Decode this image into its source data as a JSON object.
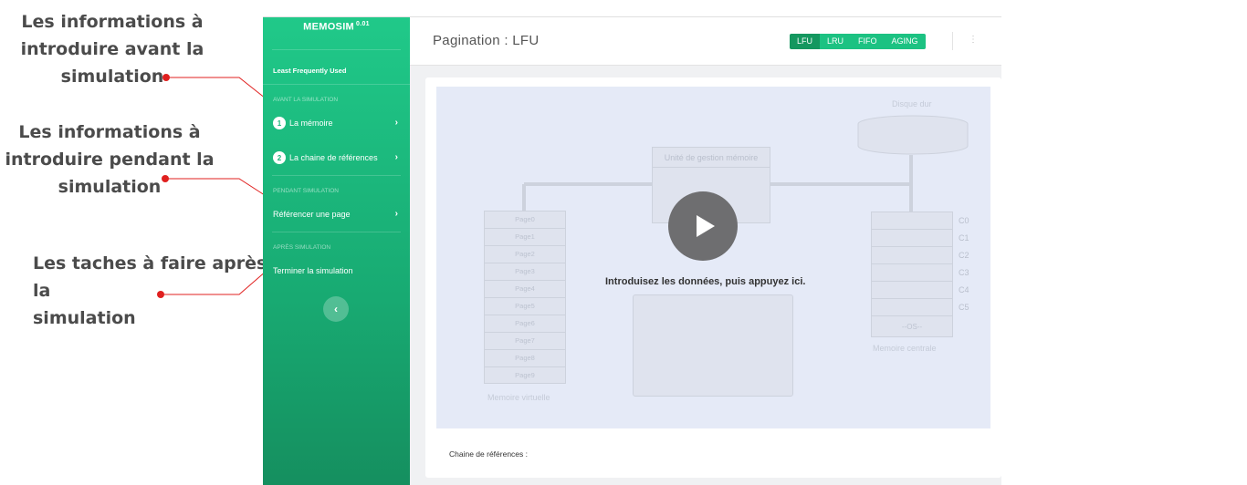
{
  "annotations": {
    "before": [
      "Les informations à",
      "introduire avant la",
      "simulation"
    ],
    "during": [
      "Les informations à",
      "introduire pendant la",
      "simulation"
    ],
    "after": [
      "Les taches à faire après la",
      "simulation"
    ]
  },
  "sidebar": {
    "brand": "MEMOSIM",
    "version": "0.01",
    "subtitle": "Least Frequently Used",
    "sections": [
      {
        "title": "AVANT LA SIMULATION",
        "items": [
          {
            "num": "1",
            "label": "La mémoire"
          },
          {
            "num": "2",
            "label": "La chaine de références"
          }
        ]
      },
      {
        "title": "PENDANT SIMULATION",
        "items": [
          {
            "label": "Référencer une page"
          }
        ]
      },
      {
        "title": "APRÈS SIMULATION",
        "items": [
          {
            "label": "Terminer la simulation"
          }
        ]
      }
    ],
    "collapse_icon": "chevron-left-icon"
  },
  "header": {
    "title": "Pagination : LFU",
    "algorithms": [
      "LFU",
      "LRU",
      "FIFO",
      "AGING"
    ],
    "active_algorithm": "LFU",
    "menu_icon": "kebab-menu-icon"
  },
  "simulation": {
    "hard_disk_label": "Disque dur",
    "mmu_label": "Unité de gestion mémoire",
    "virtual_memory_label": "Memoire virtuelle",
    "virtual_pages": [
      "Page0",
      "Page1",
      "Page2",
      "Page3",
      "Page4",
      "Page5",
      "Page6",
      "Page7",
      "Page8",
      "Page9"
    ],
    "central_memory_label": "Memoire centrale",
    "frames": [
      "C0",
      "C1",
      "C2",
      "C3",
      "C4",
      "C5"
    ],
    "os_label": "--OS--",
    "cta": "Introduisez les données, puis appuyez ici."
  },
  "footer": {
    "reference_chain_label": "Chaine de références :"
  },
  "colors": {
    "sidebar_green": "#20c989",
    "accent": "#1cc282",
    "annotation_red": "#e0201f"
  }
}
